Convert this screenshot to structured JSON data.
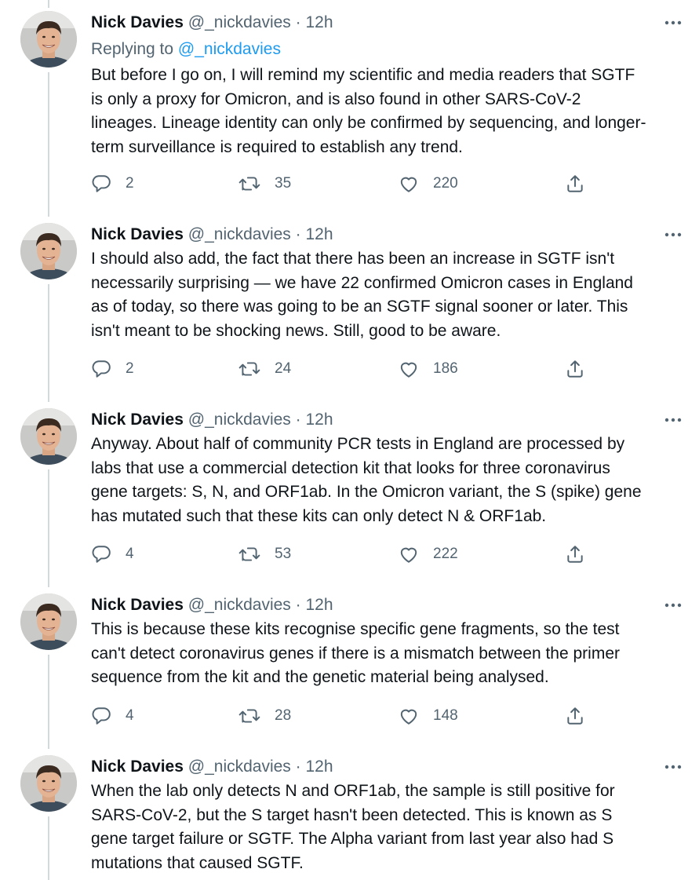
{
  "author": {
    "name": "Nick Davies",
    "handle": "@_nickdavies",
    "separator": "·",
    "time": "12h"
  },
  "colors": {
    "link": "#1d9bf0",
    "secondary_text": "#536471",
    "thread_line": "#cfd9de"
  },
  "tweets": [
    {
      "replying_label": "Replying to",
      "replying_handle": "@_nickdavies",
      "text": "But before I go on, I will remind my scientific and media readers that SGTF\nis only a proxy for Omicron, and is also found in other SARS-CoV-2\nlineages. Lineage identity can only be confirmed by sequencing, and longer-\nterm surveillance is required to establish any trend.",
      "replies": "2",
      "retweets": "35",
      "likes": "220"
    },
    {
      "text": "I should also add, the fact that there has been an increase in SGTF isn't\nnecessarily surprising — we have 22 confirmed Omicron cases in England\nas of today, so there was going to be an SGTF signal sooner or later. This\nisn't meant to be shocking news. Still, good to be aware.",
      "replies": "2",
      "retweets": "24",
      "likes": "186"
    },
    {
      "text": "Anyway. About half of community PCR tests in England are processed by\nlabs that use a commercial detection kit that looks for three coronavirus\ngene targets: S, N, and ORF1ab. In the Omicron variant, the S (spike) gene\nhas mutated such that these kits can only detect N & ORF1ab.",
      "replies": "4",
      "retweets": "53",
      "likes": "222"
    },
    {
      "text": "This is because these kits recognise specific gene fragments, so the test\ncan't detect coronavirus genes if there is a mismatch between the primer\nsequence from the kit and the genetic material being analysed.",
      "replies": "4",
      "retweets": "28",
      "likes": "148"
    },
    {
      "text": "When the lab only detects N and ORF1ab, the sample is still positive for\nSARS-CoV-2, but the S target hasn't been detected. This is known as S\ngene target failure or SGTF. The Alpha variant from last year also had S\nmutations that caused SGTF."
    }
  ]
}
